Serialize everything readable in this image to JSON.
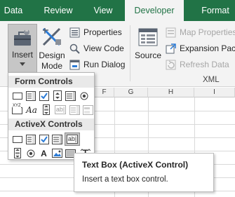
{
  "tabs": [
    {
      "label": "Data",
      "active": false
    },
    {
      "label": "Review",
      "active": false
    },
    {
      "label": "View",
      "active": false
    },
    {
      "label": "Developer",
      "active": true
    },
    {
      "label": "Format",
      "active": false
    }
  ],
  "ribbon": {
    "insert_label": "Insert",
    "design_mode_line1": "Design",
    "design_mode_line2": "Mode",
    "properties_label": "Properties",
    "view_code_label": "View Code",
    "run_dialog_label": "Run Dialog",
    "source_label": "Source",
    "map_properties_label": "Map Properties",
    "expansion_packs_label": "Expansion Packs",
    "refresh_data_label": "Refresh Data",
    "xml_group_label": "XML"
  },
  "sheet": {
    "column_headers": [
      "F",
      "G",
      "H",
      "I"
    ]
  },
  "insert_menu": {
    "form_controls_title": "Form Controls",
    "activex_controls_title": "ActiveX Controls",
    "form_controls": [
      "button-icon",
      "combo-box-icon",
      "checkbox-icon",
      "spin-button-icon",
      "list-box-icon",
      "option-button-icon",
      "group-box-icon",
      "label-icon",
      "scroll-bar-icon",
      "text-field-icon",
      "combo-list-edit-icon",
      "combo-drop-down-edit-icon"
    ],
    "activex_controls": [
      "command-button-icon",
      "combo-box-icon",
      "checkbox-icon",
      "list-box-icon",
      "text-box-icon",
      "scroll-bar-icon",
      "option-button-icon",
      "label-icon",
      "image-icon",
      "toggle-button-icon",
      "more-controls-icon"
    ],
    "form_label_glyph": "Aa",
    "activex_label_glyph": "A",
    "text_field_glyph": "ab|",
    "group_box_glyph": "XYZ",
    "more_controls_glyph": "T"
  },
  "tooltip": {
    "title": "Text Box (ActiveX Control)",
    "description": "Insert a text box control."
  },
  "colors": {
    "accent": "#217346",
    "ribbon_bg": "#f3f3f3",
    "disabled_text": "#a6a6a6",
    "checkbox_blue": "#2b7bd6"
  }
}
